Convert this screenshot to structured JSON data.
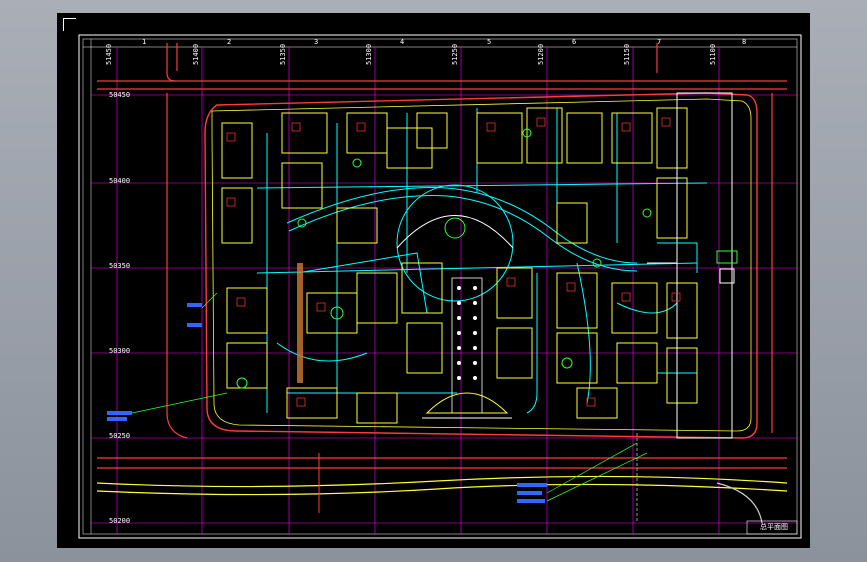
{
  "viewport": {
    "grid_labels_top": [
      "1",
      "2",
      "3",
      "4",
      "5",
      "6",
      "7",
      "8"
    ],
    "coords_left": [
      "50450",
      "50400",
      "50350",
      "50300",
      "50250",
      "50200"
    ],
    "coords_top": [
      "51450",
      "51400",
      "51350",
      "51300",
      "51250",
      "51200",
      "51150",
      "51100"
    ],
    "title_block": "总平面图",
    "colors": {
      "background": "#000000",
      "frame": "#ffffff",
      "road": "#ff3b3b",
      "building": "#ffff33",
      "pipe": "#00ffff",
      "grid": "#ff00ff",
      "green": "#33ff33",
      "annotation": "#3366ff"
    }
  }
}
